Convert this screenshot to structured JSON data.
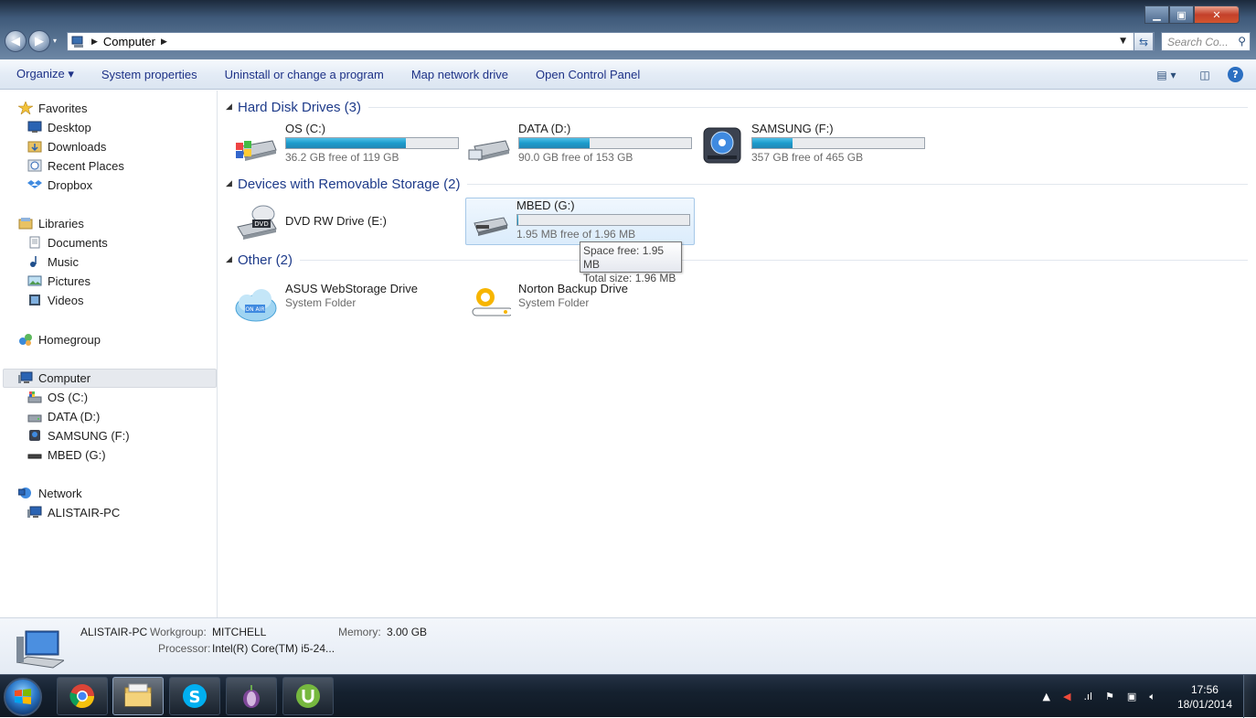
{
  "window": {
    "title": "Computer",
    "controls": {
      "minimize": "minimize",
      "maximize": "maximize",
      "close": "close"
    }
  },
  "address_bar": {
    "breadcrumb": [
      "Computer"
    ],
    "search_placeholder": "Search Co..."
  },
  "toolbar": {
    "items": [
      "Organize ▾",
      "System properties",
      "Uninstall or change a program",
      "Map network drive",
      "Open Control Panel"
    ],
    "view_icons": [
      "views-icon",
      "preview-pane-icon",
      "help-icon"
    ]
  },
  "sidebar": {
    "favorites": {
      "label": "Favorites",
      "items": [
        "Desktop",
        "Downloads",
        "Recent Places",
        "Dropbox"
      ]
    },
    "libraries": {
      "label": "Libraries",
      "items": [
        "Documents",
        "Music",
        "Pictures",
        "Videos"
      ]
    },
    "homegroup": {
      "label": "Homegroup"
    },
    "computer": {
      "label": "Computer",
      "items": [
        "OS (C:)",
        "DATA (D:)",
        "SAMSUNG (F:)",
        "MBED (G:)"
      ]
    },
    "network": {
      "label": "Network",
      "items": [
        "ALISTAIR-PC"
      ]
    }
  },
  "groups": {
    "hard_disks": {
      "title": "Hard Disk Drives (3)",
      "drives": [
        {
          "name": "OS (C:)",
          "free_text": "36.2 GB free of 119 GB",
          "used_fraction": 0.696
        },
        {
          "name": "DATA (D:)",
          "free_text": "90.0 GB free of 153 GB",
          "used_fraction": 0.412
        },
        {
          "name": "SAMSUNG (F:)",
          "free_text": "357 GB free of 465 GB",
          "used_fraction": 0.232
        }
      ]
    },
    "removable": {
      "title": "Devices with Removable Storage (2)",
      "drives": [
        {
          "name": "DVD RW Drive (E:)"
        },
        {
          "name": "MBED (G:)",
          "free_text": "1.95 MB free of 1.96 MB",
          "used_fraction": 0.005
        }
      ]
    },
    "other": {
      "title": "Other (2)",
      "items": [
        {
          "name": "ASUS WebStorage Drive",
          "type": "System Folder"
        },
        {
          "name": "Norton Backup Drive",
          "type": "System Folder"
        }
      ]
    }
  },
  "tooltip": {
    "line1": "Space free: 1.95 MB",
    "line2": "Total size: 1.96 MB"
  },
  "details": {
    "pc_name": "ALISTAIR-PC",
    "workgroup_label": "Workgroup:",
    "workgroup": "MITCHELL",
    "memory_label": "Memory:",
    "memory": "3.00 GB",
    "processor_label": "Processor:",
    "processor": "Intel(R) Core(TM) i5-24..."
  },
  "taskbar": {
    "apps": [
      "chrome-icon",
      "explorer-icon",
      "skype-icon",
      "tor-icon",
      "utorrent-icon"
    ],
    "time": "17:56",
    "date": "18/01/2014"
  },
  "colors": {
    "accent": "#1e3b8a",
    "bar_fill": "#1c9bcc",
    "selection": "#dbecfb"
  }
}
